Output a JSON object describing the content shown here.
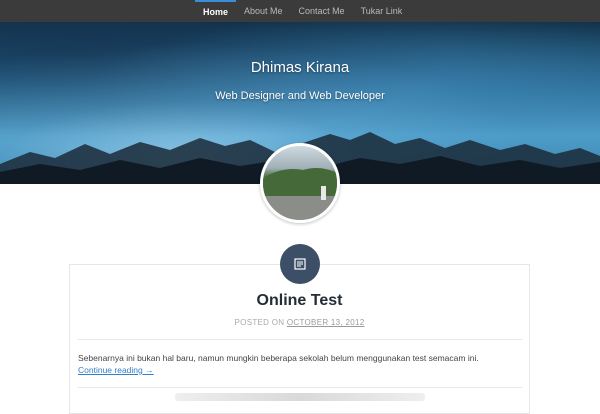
{
  "nav": {
    "items": [
      {
        "label": "Home",
        "active": true
      },
      {
        "label": "About Me",
        "active": false
      },
      {
        "label": "Contact Me",
        "active": false
      },
      {
        "label": "Tukar Link",
        "active": false
      }
    ]
  },
  "header": {
    "site_title": "Dhimas Kirana",
    "tagline": "Web Designer and Web Developer"
  },
  "post": {
    "format_icon": "standard-post-icon",
    "title": "Online Test",
    "posted_on_label": "POSTED ON",
    "date": "OCTOBER 13, 2012",
    "excerpt": "Sebenarnya ini bukan hal baru, namun mungkin beberapa sekolah belum menggunakan test semacam ini.",
    "more_link": "Continue reading →"
  },
  "colors": {
    "nav_bg": "#3b3b3b",
    "accent": "#3a8ed8",
    "badge_bg": "#3d4f66",
    "link": "#2f7fc9"
  }
}
